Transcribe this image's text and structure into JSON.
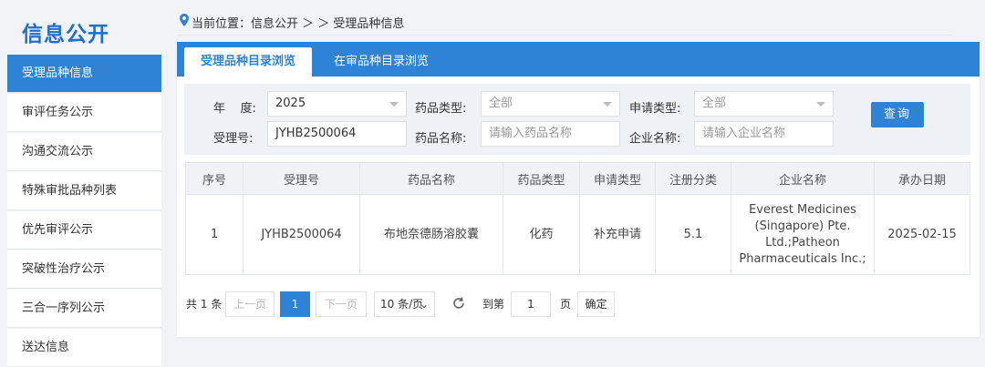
{
  "sidebar": {
    "title": "信息公开",
    "items": [
      {
        "label": "受理品种信息",
        "active": true
      },
      {
        "label": "审评任务公示"
      },
      {
        "label": "沟通交流公示"
      },
      {
        "label": "特殊审批品种列表"
      },
      {
        "label": "优先审评公示"
      },
      {
        "label": "突破性治疗公示"
      },
      {
        "label": "三合一序列公示"
      },
      {
        "label": "送达信息"
      }
    ]
  },
  "breadcrumb": {
    "text": "当前位置：信息公开 ＞ ＞ 受理品种信息"
  },
  "tabs": [
    {
      "label": "受理品种目录浏览",
      "active": true
    },
    {
      "label": "在审品种目录浏览"
    }
  ],
  "filter": {
    "year_label": "年    度:",
    "year_value": "2025",
    "drug_type_label": "药品类型:",
    "drug_type_value": "全部",
    "apply_type_label": "申请类型:",
    "apply_type_value": "全部",
    "accept_no_label": "受理号:",
    "accept_no_value": "JYHB2500064",
    "drug_name_label": "药品名称:",
    "drug_name_placeholder": "请输入药品名称",
    "company_label": "企业名称:",
    "company_placeholder": "请输入企业名称",
    "query_label": "查询"
  },
  "table": {
    "headers": [
      "序号",
      "受理号",
      "药品名称",
      "药品类型",
      "申请类型",
      "注册分类",
      "企业名称",
      "承办日期"
    ],
    "rows": [
      [
        "1",
        "JYHB2500064",
        "布地奈德肠溶胶囊",
        "化药",
        "补充申请",
        "5.1",
        "Everest Medicines (Singapore) Pte. Ltd.;Patheon Pharmaceuticals Inc.;",
        "2025-02-15"
      ]
    ]
  },
  "pager": {
    "total": "共 1 条",
    "prev": "上一页",
    "current": "1",
    "next": "下一页",
    "page_size": "10 条/页",
    "goto_label": "到第",
    "goto_value": "1",
    "page_unit": "页",
    "confirm": "确定"
  },
  "colors": {
    "accent": "#2e83d6",
    "brand_title": "#1d6fd1"
  },
  "icons": {
    "breadcrumb": "location-pin-icon",
    "refresh": "refresh-icon",
    "dropdown": "chevron-down-icon"
  }
}
